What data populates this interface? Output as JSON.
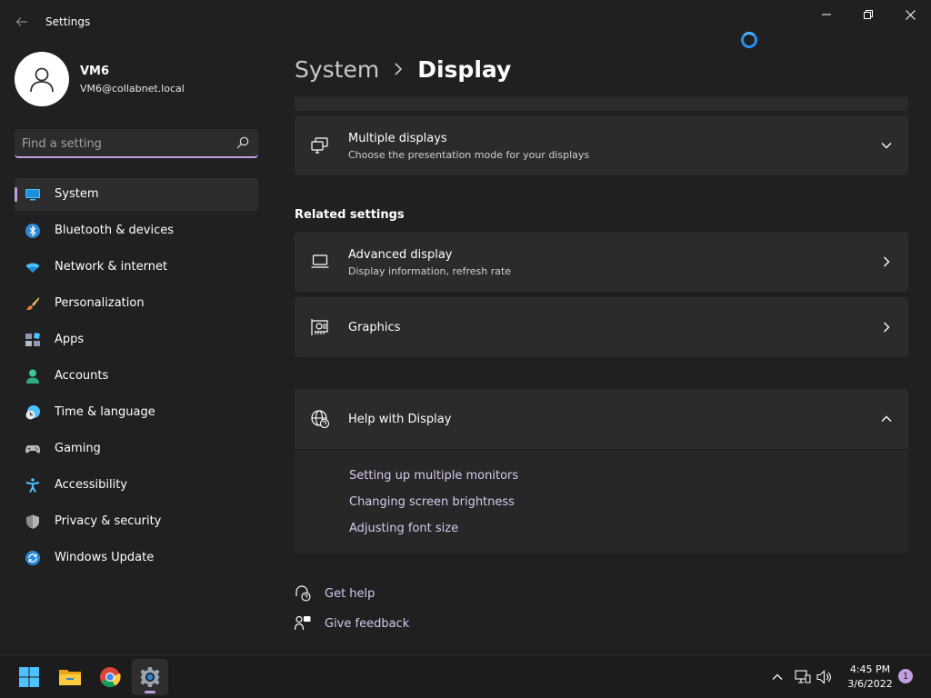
{
  "window": {
    "title": "Settings"
  },
  "profile": {
    "name": "VM6",
    "email": "VM6@collabnet.local"
  },
  "search": {
    "placeholder": "Find a setting"
  },
  "nav": [
    {
      "label": "System",
      "icon": "monitor-icon",
      "active": true
    },
    {
      "label": "Bluetooth & devices",
      "icon": "bluetooth-icon"
    },
    {
      "label": "Network & internet",
      "icon": "wifi-icon"
    },
    {
      "label": "Personalization",
      "icon": "brush-icon"
    },
    {
      "label": "Apps",
      "icon": "apps-icon"
    },
    {
      "label": "Accounts",
      "icon": "person-icon"
    },
    {
      "label": "Time & language",
      "icon": "clock-globe-icon"
    },
    {
      "label": "Gaming",
      "icon": "gamepad-icon"
    },
    {
      "label": "Accessibility",
      "icon": "accessibility-icon"
    },
    {
      "label": "Privacy & security",
      "icon": "shield-icon"
    },
    {
      "label": "Windows Update",
      "icon": "update-icon"
    }
  ],
  "breadcrumb": {
    "parent": "System",
    "current": "Display"
  },
  "cards": {
    "multiple_displays": {
      "title": "Multiple displays",
      "subtitle": "Choose the presentation mode for your displays"
    },
    "related_settings_title": "Related settings",
    "advanced_display": {
      "title": "Advanced display",
      "subtitle": "Display information, refresh rate"
    },
    "graphics": {
      "title": "Graphics"
    },
    "help": {
      "title": "Help with Display",
      "links": [
        "Setting up multiple monitors",
        "Changing screen brightness",
        "Adjusting font size"
      ]
    }
  },
  "footer": {
    "get_help": "Get help",
    "give_feedback": "Give feedback"
  },
  "taskbar": {
    "time": "4:45 PM",
    "date": "3/6/2022",
    "notification_count": "1"
  },
  "colors": {
    "accent": "#c39fe0",
    "background": "#202020",
    "card": "#2b2b2b"
  }
}
